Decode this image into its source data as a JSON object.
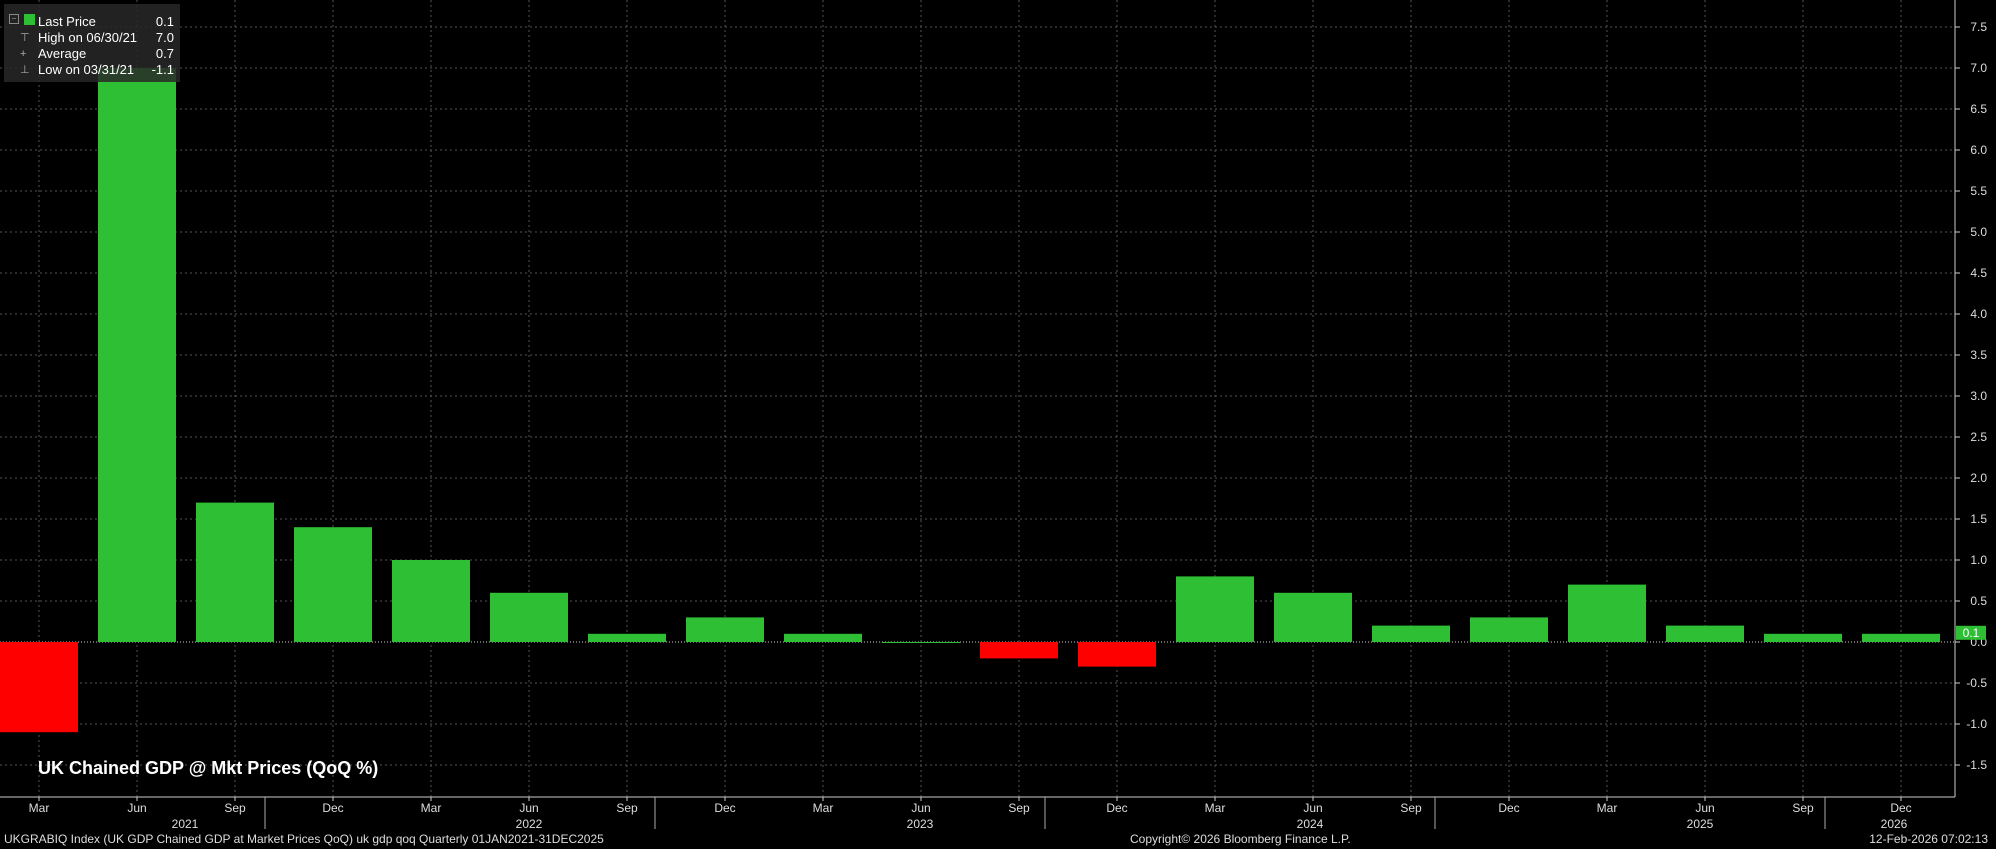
{
  "chart_data": {
    "type": "bar",
    "title": "UK Chained GDP @ Mkt Prices (QoQ %)",
    "categories": [
      "Mar 2021",
      "Jun 2021",
      "Sep 2021",
      "Dec 2021",
      "Mar 2022",
      "Jun 2022",
      "Sep 2022",
      "Dec 2022",
      "Mar 2023",
      "Jun 2023",
      "Sep 2023",
      "Dec 2023",
      "Mar 2024",
      "Jun 2024",
      "Sep 2024",
      "Dec 2024",
      "Mar 2025",
      "Jun 2025",
      "Sep 2025",
      "Dec 2025"
    ],
    "values": [
      -1.1,
      7.0,
      1.7,
      1.4,
      1.0,
      0.6,
      0.1,
      0.3,
      0.1,
      0.0,
      -0.2,
      -0.3,
      0.8,
      0.6,
      0.2,
      0.3,
      0.7,
      0.2,
      0.1,
      0.1
    ],
    "ylim": [
      -1.9,
      7.8
    ],
    "y_ticks": [
      "-1.5",
      "-1.0",
      "-0.5",
      "0.0",
      "0.5",
      "1.0",
      "1.5",
      "2.0",
      "2.5",
      "3.0",
      "3.5",
      "4.0",
      "4.5",
      "5.0",
      "5.5",
      "6.0",
      "6.5",
      "7.0",
      "7.5"
    ],
    "x_month_labels": [
      "Mar",
      "Jun",
      "Sep",
      "Dec",
      "Mar",
      "Jun",
      "Sep",
      "Dec",
      "Mar",
      "Jun",
      "Sep",
      "Dec",
      "Mar",
      "Jun",
      "Sep",
      "Dec",
      "Mar",
      "Jun",
      "Sep",
      "Dec"
    ],
    "x_year_labels": [
      "2021",
      "2022",
      "2023",
      "2024",
      "2025",
      "2026"
    ],
    "last_price_label": "0.1",
    "grid": true,
    "legend_position": "top-left",
    "colors": {
      "positive": "#2fbf35",
      "negative": "#ff0000",
      "background": "#000000",
      "grid": "#555555",
      "last_label_bg": "#2fbf35"
    }
  },
  "legend": {
    "rows": [
      {
        "label": "Last Price",
        "value": "0.1"
      },
      {
        "label": "High on 06/30/21",
        "value": "7.0"
      },
      {
        "label": "Average",
        "value": "0.7"
      },
      {
        "label": "Low on 03/31/21",
        "value": "-1.1"
      }
    ]
  },
  "footer": {
    "left": "UKGRABIQ Index (UK GDP Chained GDP at Market Prices QoQ) uk gdp qoq Quarterly 01JAN2021-31DEC2025",
    "center": "Copyright© 2026 Bloomberg Finance L.P.",
    "right": "12-Feb-2026 07:02:13"
  }
}
